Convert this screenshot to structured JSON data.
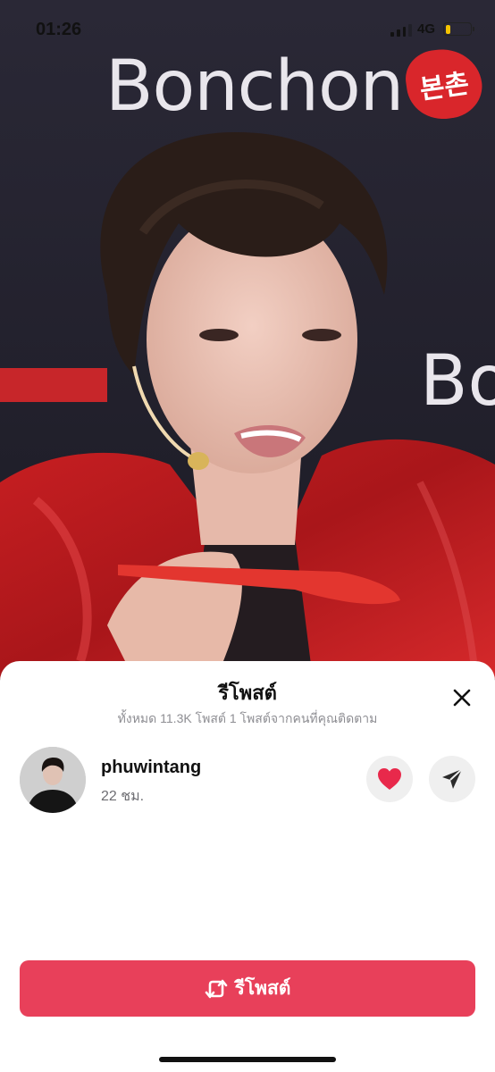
{
  "status_bar": {
    "time": "01:26",
    "network": "4G",
    "battery_color": "#f4c300"
  },
  "background": {
    "brand_name": "Bonchon",
    "brand_badge": "본촌",
    "brand_name_partial": "Bo"
  },
  "sheet": {
    "title": "รีโพสต์",
    "subtitle": "ทั้งหมด 11.3K โพสต์ 1 โพสต์จากคนที่คุณติดตาม",
    "close_icon": "close-icon",
    "user": {
      "username": "phuwintang",
      "time_ago": "22 ชม."
    },
    "like_icon": "heart-icon",
    "like_color": "#e8294b",
    "share_icon": "send-icon",
    "repost_button": {
      "label": "รีโพสต์",
      "icon": "repost-icon",
      "color": "#e8405a"
    }
  }
}
